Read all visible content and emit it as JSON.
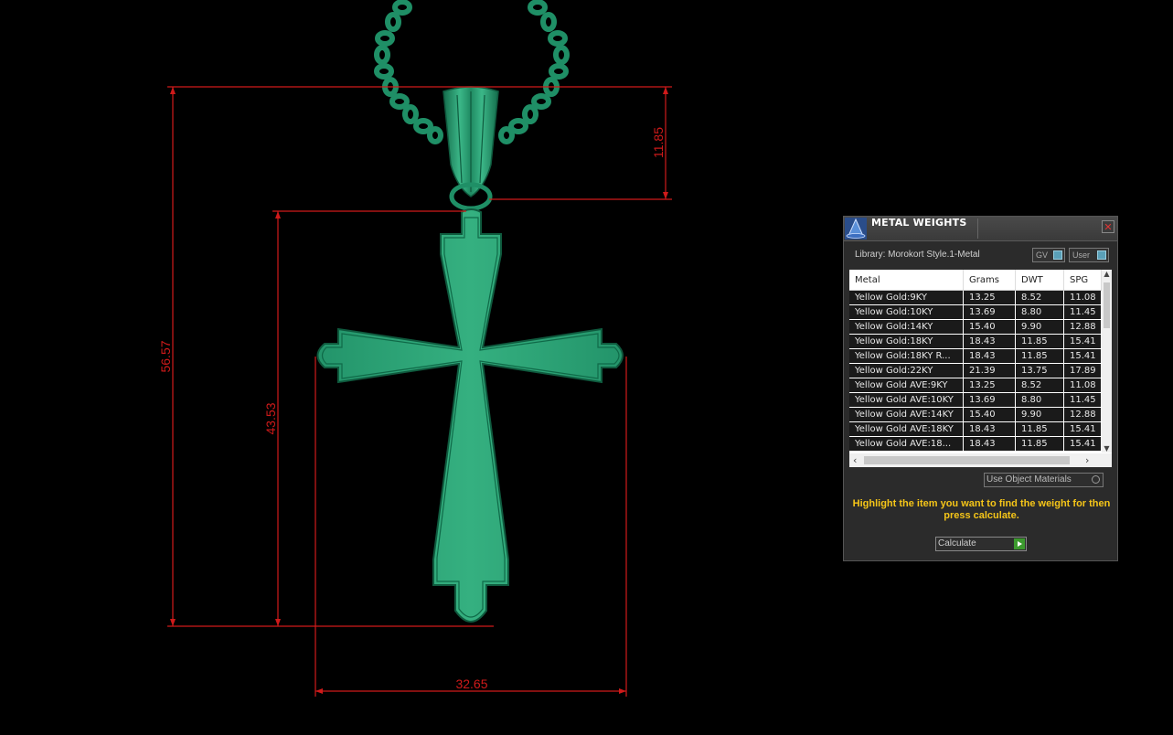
{
  "dimensions": {
    "total_height": "56.57",
    "cross_height": "43.53",
    "bail_height": "11.85",
    "width": "32.65"
  },
  "panel": {
    "title": "METAL WEIGHTS",
    "close_label": "✕",
    "library_label": "Library: Morokort Style.1-Metal",
    "gv_label": "GV",
    "user_label": "User",
    "columns": [
      "Metal",
      "Grams",
      "DWT",
      "SPG"
    ],
    "rows": [
      [
        "Yellow Gold:9KY",
        "13.25",
        "8.52",
        "11.08"
      ],
      [
        "Yellow Gold:10KY",
        "13.69",
        "8.80",
        "11.45"
      ],
      [
        "Yellow Gold:14KY",
        "15.40",
        "9.90",
        "12.88"
      ],
      [
        "Yellow Gold:18KY",
        "18.43",
        "11.85",
        "15.41"
      ],
      [
        "Yellow Gold:18KY R...",
        "18.43",
        "11.85",
        "15.41"
      ],
      [
        "Yellow Gold:22KY",
        "21.39",
        "13.75",
        "17.89"
      ],
      [
        "Yellow Gold AVE:9KY",
        "13.25",
        "8.52",
        "11.08"
      ],
      [
        "Yellow Gold AVE:10KY",
        "13.69",
        "8.80",
        "11.45"
      ],
      [
        "Yellow Gold AVE:14KY",
        "15.40",
        "9.90",
        "12.88"
      ],
      [
        "Yellow Gold AVE:18KY",
        "18.43",
        "11.85",
        "15.41"
      ],
      [
        "Yellow Gold AVE:18...",
        "18.43",
        "11.85",
        "15.41"
      ]
    ],
    "use_object_materials_label": "Use Object Materials",
    "instruction": "Highlight the item you want to find the weight for then press calculate.",
    "calculate_label": "Calculate"
  },
  "colors": {
    "background": "#000000",
    "model": "#2fa67a",
    "dimension_lines": "#d01a1a",
    "instruction_text": "#f5c518"
  }
}
